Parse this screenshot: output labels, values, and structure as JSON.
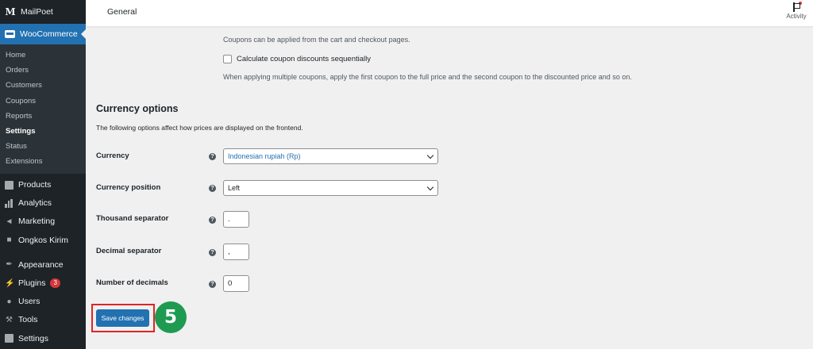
{
  "sidebar": {
    "top_label": "MailPoet",
    "top_logo_letter": "M",
    "woocommerce_label": "WooCommerce",
    "submenu": [
      "Home",
      "Orders",
      "Customers",
      "Coupons",
      "Reports",
      "Settings",
      "Status",
      "Extensions"
    ],
    "current_submenu": "Settings",
    "menu": [
      {
        "label": "Products",
        "icon": "archive-icon"
      },
      {
        "label": "Analytics",
        "icon": "bar-chart-icon"
      },
      {
        "label": "Marketing",
        "icon": "megaphone-icon"
      },
      {
        "label": "Ongkos Kirim",
        "icon": "truck-icon"
      },
      {
        "label": "Appearance",
        "icon": "paintbrush-icon"
      },
      {
        "label": "Plugins",
        "icon": "plug-icon",
        "badge": "3"
      },
      {
        "label": "Users",
        "icon": "user-icon"
      },
      {
        "label": "Tools",
        "icon": "wrench-icon"
      },
      {
        "label": "Settings",
        "icon": "settings-icon"
      }
    ]
  },
  "topbar": {
    "title": "General",
    "activity_label": "Activity"
  },
  "coupons": {
    "desc1": "Coupons can be applied from the cart and checkout pages.",
    "sequential_label": "Calculate coupon discounts sequentially",
    "sequential_desc": "When applying multiple coupons, apply the first coupon to the full price and the second coupon to the discounted price and so on."
  },
  "currency": {
    "heading": "Currency options",
    "description": "The following options affect how prices are displayed on the frontend.",
    "currency_label": "Currency",
    "currency_value": "Indonesian rupiah (Rp)",
    "position_label": "Currency position",
    "position_value": "Left",
    "thousand_label": "Thousand separator",
    "thousand_value": ".",
    "decimal_label": "Decimal separator",
    "decimal_value": ",",
    "decimals_label": "Number of decimals",
    "decimals_value": "0"
  },
  "actions": {
    "save_label": "Save changes",
    "step_number": "5"
  },
  "colors": {
    "admin_bar": "#1d2327",
    "primary": "#2271b1",
    "highlight": "#e02424",
    "step_badge": "#1e9b50"
  }
}
